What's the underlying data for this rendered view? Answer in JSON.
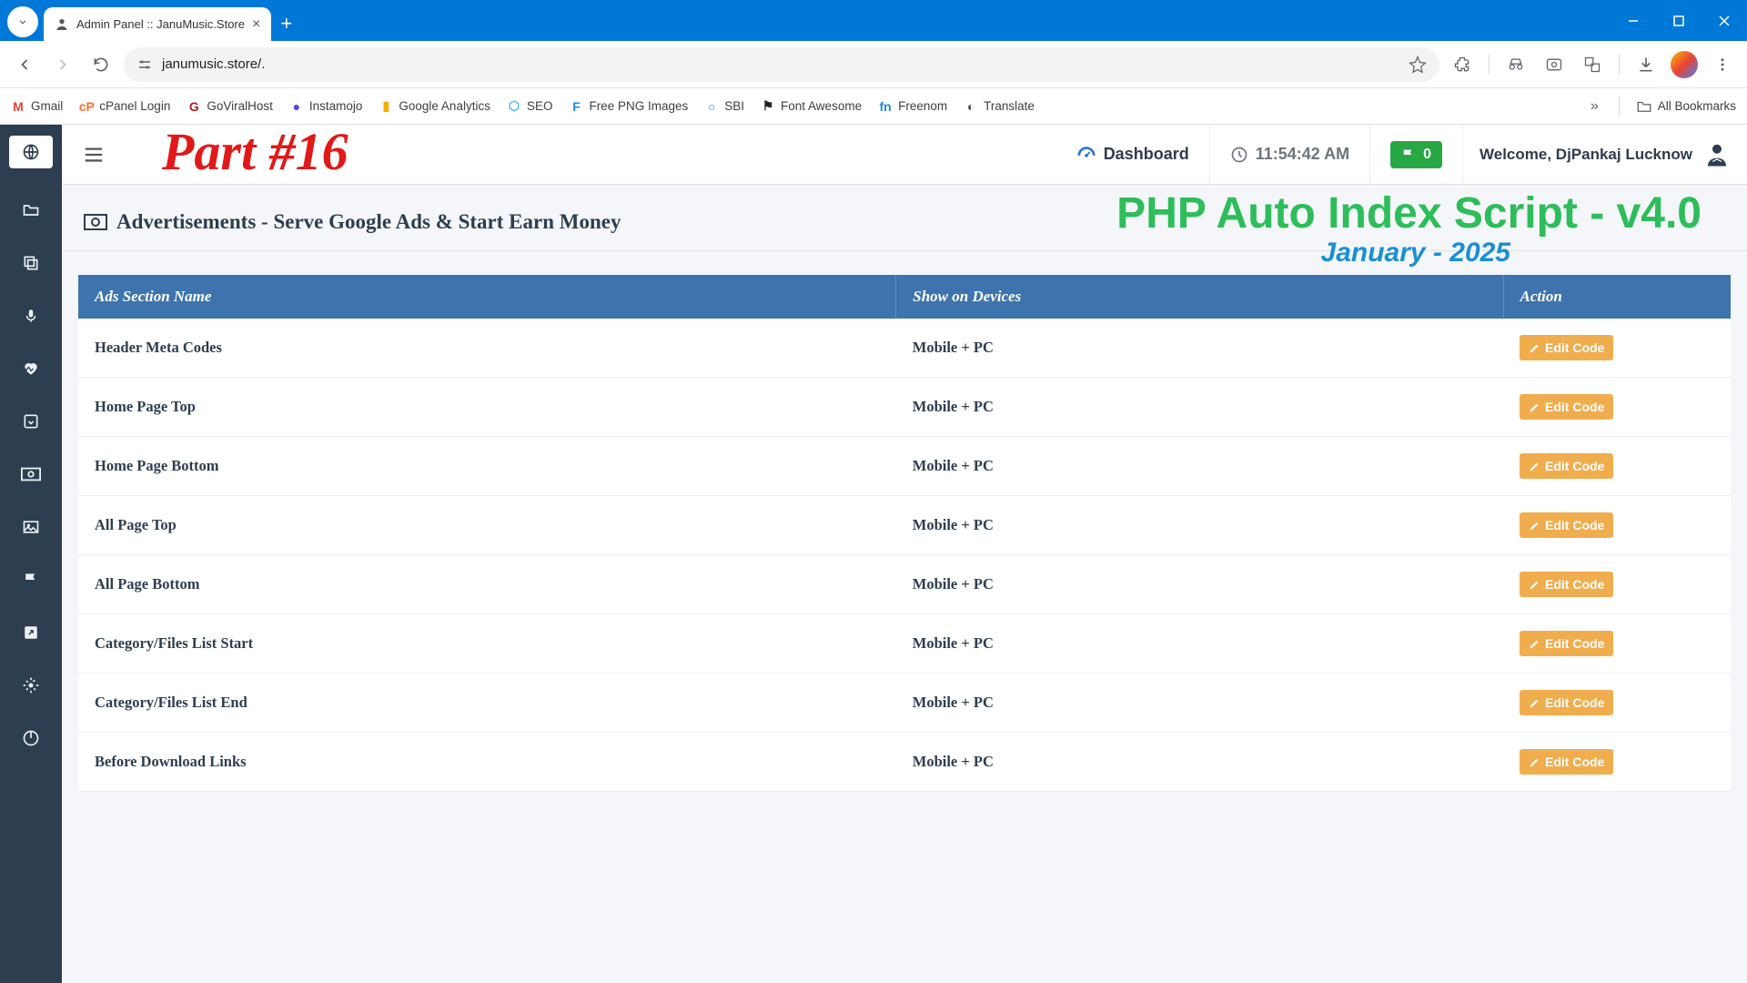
{
  "browser": {
    "tab_title": "Admin Panel :: JanuMusic.Store",
    "url": "janumusic.store/.",
    "bookmarks": [
      {
        "label": "Gmail",
        "color": "#ea4335",
        "glyph": "M"
      },
      {
        "label": "cPanel Login",
        "color": "#ff6c2c",
        "glyph": "cP"
      },
      {
        "label": "GoViralHost",
        "color": "#b31b1b",
        "glyph": "G"
      },
      {
        "label": "Instamojo",
        "color": "#4f46e5",
        "glyph": "●"
      },
      {
        "label": "Google Analytics",
        "color": "#f9ab00",
        "glyph": "▮"
      },
      {
        "label": "SEO",
        "color": "#4cb5f5",
        "glyph": "⬡"
      },
      {
        "label": "Free PNG Images",
        "color": "#1e88e5",
        "glyph": "F"
      },
      {
        "label": "SBI",
        "color": "#1e88e5",
        "glyph": "○"
      },
      {
        "label": "Font Awesome",
        "color": "#222",
        "glyph": "⚑"
      },
      {
        "label": "Freenom",
        "color": "#1e88e5",
        "glyph": "fn"
      },
      {
        "label": "Translate",
        "color": "#555",
        "glyph": "◐"
      }
    ],
    "all_bookmarks": "All Bookmarks"
  },
  "overlay": {
    "part": "Part #16",
    "version": "PHP Auto Index Script - v4.0",
    "month": "January - 2025"
  },
  "topbar": {
    "dashboard": "Dashboard",
    "time": "11:54:42 AM",
    "flag_count": "0",
    "welcome": "Welcome, DjPankaj Lucknow"
  },
  "page": {
    "title": "Advertisements - Serve Google Ads & Start Earn Money"
  },
  "table": {
    "columns": [
      "Ads Section Name",
      "Show on Devices",
      "Action"
    ],
    "edit_label": "Edit Code",
    "rows": [
      {
        "name": "Header Meta Codes",
        "devices": "Mobile + PC"
      },
      {
        "name": "Home Page Top",
        "devices": "Mobile + PC"
      },
      {
        "name": "Home Page Bottom",
        "devices": "Mobile + PC"
      },
      {
        "name": "All Page Top",
        "devices": "Mobile + PC"
      },
      {
        "name": "All Page Bottom",
        "devices": "Mobile + PC"
      },
      {
        "name": "Category/Files List Start",
        "devices": "Mobile + PC"
      },
      {
        "name": "Category/Files List End",
        "devices": "Mobile + PC"
      },
      {
        "name": "Before Download Links",
        "devices": "Mobile + PC"
      }
    ]
  }
}
